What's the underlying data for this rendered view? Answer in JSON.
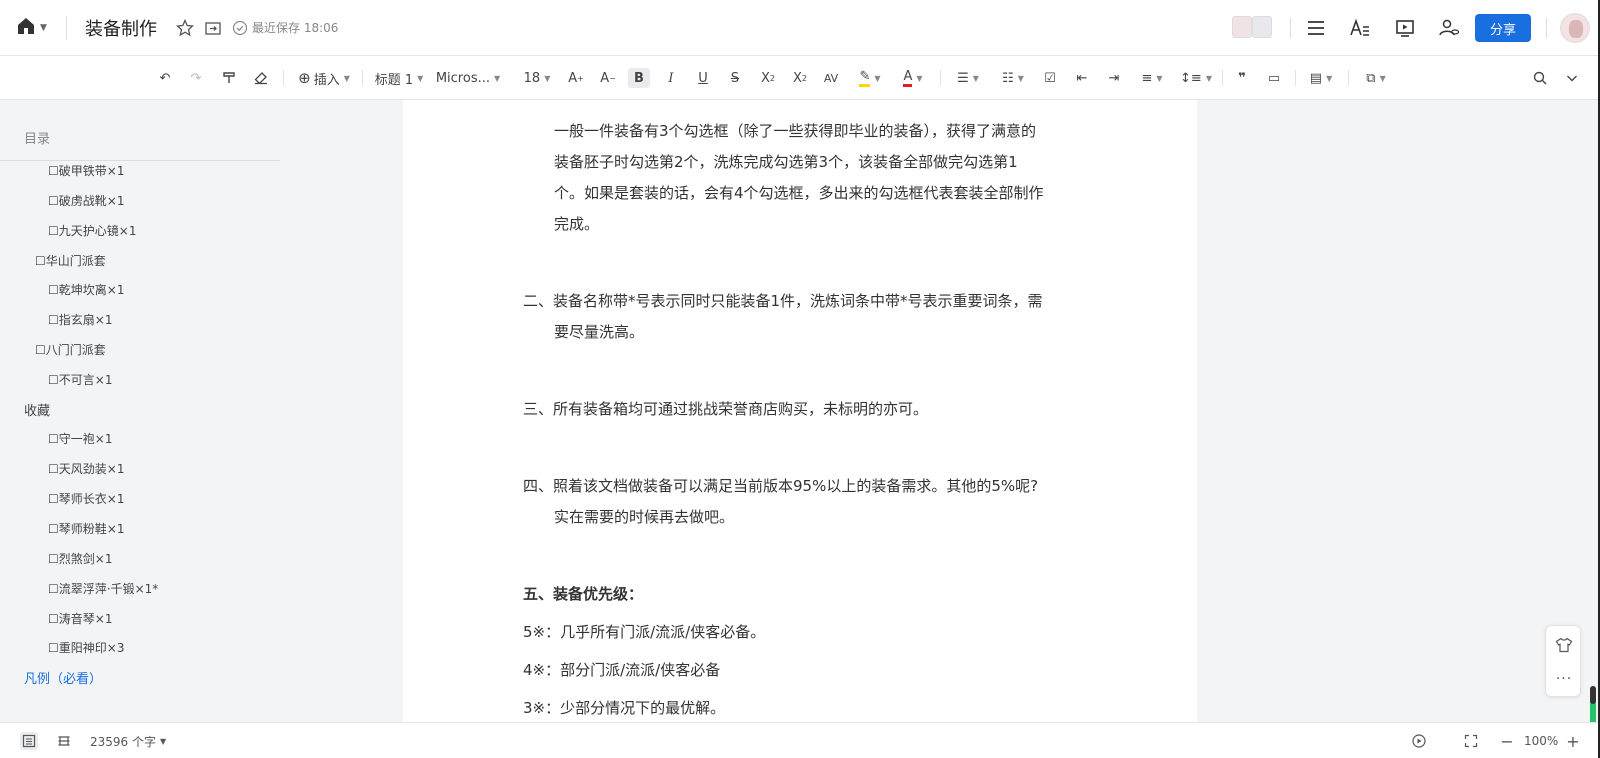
{
  "header": {
    "title": "装备制作",
    "saved_status": "最近保存 18:06",
    "share_label": "分享"
  },
  "toolbar": {
    "insert_label": "插入",
    "style_label": "标题 1",
    "font_label": "Micros...",
    "size_label": "18"
  },
  "toc": {
    "heading": "目录",
    "items": [
      "☐破甲铁带×1",
      "☐破虏战靴×1",
      "☐九天护心镜×1",
      "☐华山门派套",
      "☐乾坤坎离×1",
      "☐指玄扇×1",
      "☐八门门派套",
      "☐不可言×1",
      "收藏",
      "☐守一袍×1",
      "☐天风劲装×1",
      "☐琴师长衣×1",
      "☐琴师粉鞋×1",
      "☐烈煞剑×1",
      "☐流翠浮萍·千锻×1*",
      "☐涛音琴×1",
      "☐重阳神印×3",
      "凡例（必看）"
    ]
  },
  "document": {
    "lines": [
      "一般一件装备有3个勾选框（除了一些获得即毕业的装备），获得了满意的",
      "装备胚子时勾选第2个，洗炼完成勾选第3个，该装备全部做完勾选第1",
      "个。如果是套装的话，会有4个勾选框，多出来的勾选框代表套装全部制作",
      "完成。",
      "二、装备名称带*号表示同时只能装备1件，洗炼词条中带*号表示重要词条，需",
      "要尽量洗高。",
      "三、所有装备箱均可通过挑战荣誉商店购买，未标明的亦可。",
      "四、照着该文档做装备可以满足当前版本95%以上的装备需求。其他的5%呢?",
      "实在需要的时候再去做吧。",
      "五、装备优先级：",
      "5※：几乎所有门派/流派/侠客必备。",
      "4※：部分门派/流派/侠客必备",
      "3※：少部分情况下的最优解。"
    ]
  },
  "status": {
    "word_count": "23596 个字",
    "zoom": "100%"
  },
  "colors": {
    "accent": "#1a6fe0",
    "highlight": "#f5d90a",
    "font_color": "#e02020"
  }
}
